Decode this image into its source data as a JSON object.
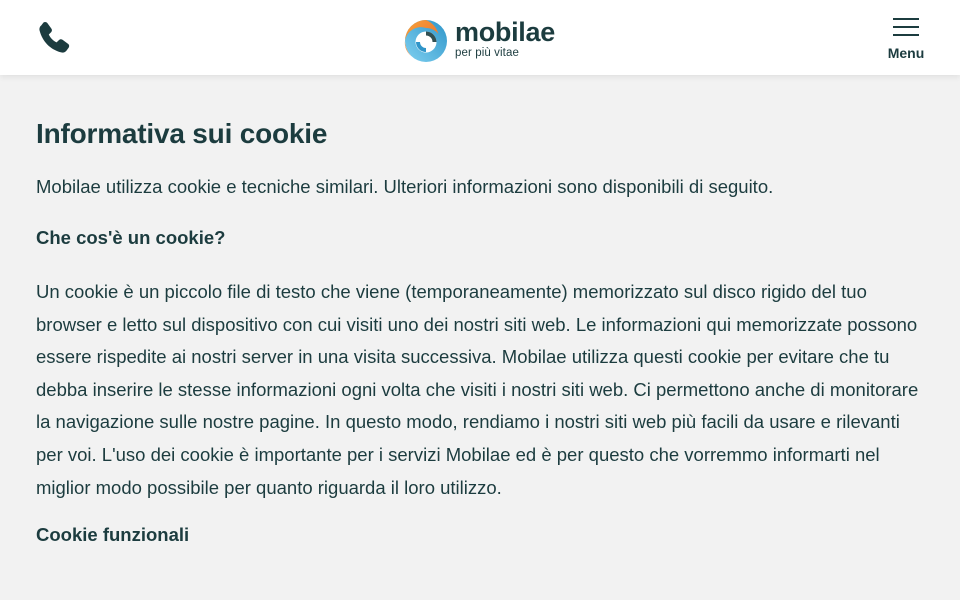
{
  "header": {
    "logo": {
      "name": "mobilae",
      "tagline": "per più vitae",
      "icon": "mobilae-swirl-logo"
    },
    "phone_icon": "phone-icon",
    "menu_label": "Menu",
    "menu_icon": "hamburger-menu-icon"
  },
  "main": {
    "title": "Informativa sui cookie",
    "intro": "Mobilae utilizza cookie e tecniche similari. Ulteriori informazioni sono disponibili di seguito.",
    "sections": [
      {
        "heading": "Che cos'è un cookie?",
        "text": "Un cookie è un piccolo file di testo che viene (temporaneamente) memorizzato sul disco rigido del tuo browser e letto sul dispositivo con cui visiti uno dei nostri siti web. Le informazioni qui memorizzate possono essere rispedite ai nostri server in una visita successiva. Mobilae utilizza questi cookie per evitare che tu debba inserire le stesse informazioni ogni volta che visiti i nostri siti web. Ci permettono anche di monitorare la navigazione sulle nostre pagine. In questo modo, rendiamo i nostri siti web più facili da usare e rilevanti per voi. L'uso dei cookie è importante per i servizi Mobilae ed è per questo che vorremmo informarti nel miglior modo possibile per quanto riguarda il loro utilizzo."
      },
      {
        "heading": "Cookie funzionali"
      }
    ]
  },
  "colors": {
    "text": "#1c3c3f",
    "background": "#f2f2f2",
    "header_bg": "#ffffff",
    "logo_orange": "#f08a2b",
    "logo_blue": "#3fa9d6"
  }
}
